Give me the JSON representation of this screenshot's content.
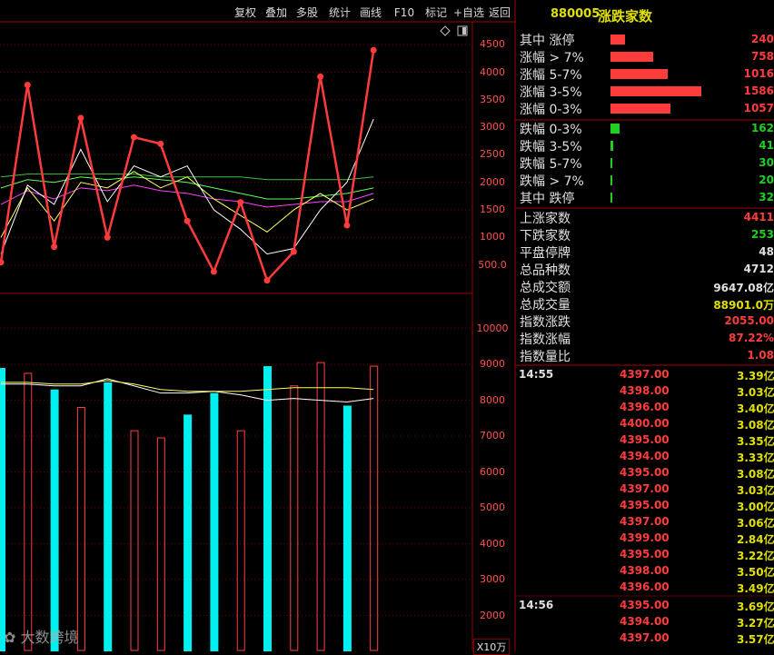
{
  "toolbar": {
    "buttons": [
      "复权",
      "叠加",
      "多股",
      "统计",
      "画线",
      "F10",
      "标记",
      "+自选",
      "返回"
    ]
  },
  "header": {
    "code": "880005",
    "name": "涨跌家数"
  },
  "dist_up": [
    {
      "label": "其中 涨停",
      "value": "240",
      "fill": 0.16
    },
    {
      "label": "涨幅 > 7%",
      "value": "758",
      "fill": 0.47
    },
    {
      "label": "涨幅 5-7%",
      "value": "1016",
      "fill": 0.63
    },
    {
      "label": "涨幅 3-5%",
      "value": "1586",
      "fill": 1.0
    },
    {
      "label": "涨幅 0-3%",
      "value": "1057",
      "fill": 0.66
    }
  ],
  "dist_down": [
    {
      "label": "跌幅 0-3%",
      "value": "162",
      "fill": 0.1
    },
    {
      "label": "跌幅 3-5%",
      "value": "41",
      "fill": 0.03
    },
    {
      "label": "跌幅 5-7%",
      "value": "30",
      "fill": 0.02
    },
    {
      "label": "跌幅 > 7%",
      "value": "20",
      "fill": 0.01
    },
    {
      "label": "其中 跌停",
      "value": "32",
      "fill": 0.02
    }
  ],
  "stats": [
    {
      "label": "上涨家数",
      "value": "4411",
      "color": "#ff3c3c"
    },
    {
      "label": "下跌家数",
      "value": "253",
      "color": "#20d020"
    },
    {
      "label": "平盘停牌",
      "value": "48",
      "color": "#e0e0e0"
    },
    {
      "label": "总品种数",
      "value": "4712",
      "color": "#e0e0e0"
    },
    {
      "label": "总成交额",
      "value": "9647.08亿",
      "color": "#e0e0e0"
    },
    {
      "label": "总成交量",
      "value": "88901.0万",
      "color": "#e0e000"
    },
    {
      "label": "指数涨跌",
      "value": "2055.00",
      "color": "#ff3c3c"
    },
    {
      "label": "指数涨幅",
      "value": "87.22%",
      "color": "#ff3c3c"
    },
    {
      "label": "指数量比",
      "value": "1.08",
      "color": "#ff3c3c"
    }
  ],
  "ticks": [
    {
      "time": "14:55",
      "price": "4397.00",
      "vol": "3.39亿"
    },
    {
      "time": "",
      "price": "4398.00",
      "vol": "3.03亿"
    },
    {
      "time": "",
      "price": "4396.00",
      "vol": "3.40亿"
    },
    {
      "time": "",
      "price": "4400.00",
      "vol": "3.08亿"
    },
    {
      "time": "",
      "price": "4395.00",
      "vol": "3.35亿"
    },
    {
      "time": "",
      "price": "4394.00",
      "vol": "3.33亿"
    },
    {
      "time": "",
      "price": "4395.00",
      "vol": "3.08亿"
    },
    {
      "time": "",
      "price": "4397.00",
      "vol": "3.03亿"
    },
    {
      "time": "",
      "price": "4395.00",
      "vol": "3.00亿"
    },
    {
      "time": "",
      "price": "4397.00",
      "vol": "3.06亿"
    },
    {
      "time": "",
      "price": "4399.00",
      "vol": "2.84亿"
    },
    {
      "time": "",
      "price": "4395.00",
      "vol": "3.22亿"
    },
    {
      "time": "",
      "price": "4398.00",
      "vol": "3.50亿"
    },
    {
      "time": "",
      "price": "4396.00",
      "vol": "3.49亿"
    },
    {
      "time": "14:56",
      "price": "4395.00",
      "vol": "3.69亿"
    },
    {
      "time": "",
      "price": "4394.00",
      "vol": "3.27亿"
    },
    {
      "time": "",
      "price": "4397.00",
      "vol": "3.57亿"
    }
  ],
  "price_axis": [
    "4500",
    "4000",
    "3500",
    "3000",
    "2500",
    "2000",
    "1500",
    "1000",
    "500.0"
  ],
  "volume_axis": [
    "10000",
    "9000",
    "8000",
    "7000",
    "6000",
    "5000",
    "4000",
    "3000",
    "2000"
  ],
  "volume_unit": "X10万",
  "watermark": "大数跨境",
  "chart_data": {
    "type": "line",
    "price": {
      "ylim": [
        0,
        4900
      ],
      "series": [
        {
          "values": [
            550,
            3770,
            830,
            3170,
            1000,
            2820,
            2700,
            1300,
            380,
            1640,
            220,
            740,
            3920,
            1220,
            4400
          ],
          "color": "#ff3c3c"
        },
        {
          "values": [
            700,
            1950,
            1600,
            2600,
            1650,
            2300,
            2100,
            2300,
            1500,
            1150,
            700,
            800,
            1500,
            2000,
            3150
          ],
          "color": "#ffffff"
        },
        {
          "values": [
            1000,
            1900,
            1300,
            2000,
            1900,
            2200,
            1900,
            2100,
            1700,
            1400,
            1100,
            1500,
            1800,
            1500,
            1700
          ],
          "color": "#ffff60"
        },
        {
          "values": [
            1600,
            1850,
            1700,
            1900,
            1850,
            1950,
            1850,
            1800,
            1700,
            1650,
            1550,
            1600,
            1650,
            1650,
            1800
          ],
          "color": "#ff40ff"
        },
        {
          "values": [
            1900,
            2050,
            2000,
            2100,
            2050,
            2100,
            2050,
            2000,
            1900,
            1800,
            1700,
            1700,
            1750,
            1800,
            1900
          ],
          "color": "#60ff60"
        },
        {
          "values": [
            2100,
            2150,
            2150,
            2150,
            2150,
            2150,
            2100,
            2100,
            2100,
            2100,
            2050,
            2050,
            2050,
            2050,
            2100
          ],
          "color": "#40c040"
        }
      ]
    },
    "volume": {
      "ylim": [
        1000,
        10800
      ],
      "bars": [
        {
          "value": 8900,
          "filled": true
        },
        {
          "value": 8750,
          "filled": false
        },
        {
          "value": 8300,
          "filled": true
        },
        {
          "value": 7800,
          "filled": false
        },
        {
          "value": 8500,
          "filled": true
        },
        {
          "value": 7150,
          "filled": false
        },
        {
          "value": 6950,
          "filled": false
        },
        {
          "value": 7600,
          "filled": true
        },
        {
          "value": 8200,
          "filled": true
        },
        {
          "value": 7150,
          "filled": false
        },
        {
          "value": 8950,
          "filled": true
        },
        {
          "value": 8400,
          "filled": false
        },
        {
          "value": 9050,
          "filled": false
        },
        {
          "value": 7850,
          "filled": true
        },
        {
          "value": 8950,
          "filled": false
        }
      ],
      "ma": [
        {
          "values": [
            8450,
            8450,
            8400,
            8400,
            8600,
            8400,
            8200,
            8200,
            8250,
            8150,
            8000,
            8050,
            8000,
            7950,
            8050
          ],
          "color": "#ffffff"
        },
        {
          "values": [
            8500,
            8500,
            8450,
            8450,
            8550,
            8450,
            8300,
            8250,
            8250,
            8250,
            8300,
            8350,
            8350,
            8350,
            8300
          ],
          "color": "#ffff60"
        }
      ]
    }
  }
}
